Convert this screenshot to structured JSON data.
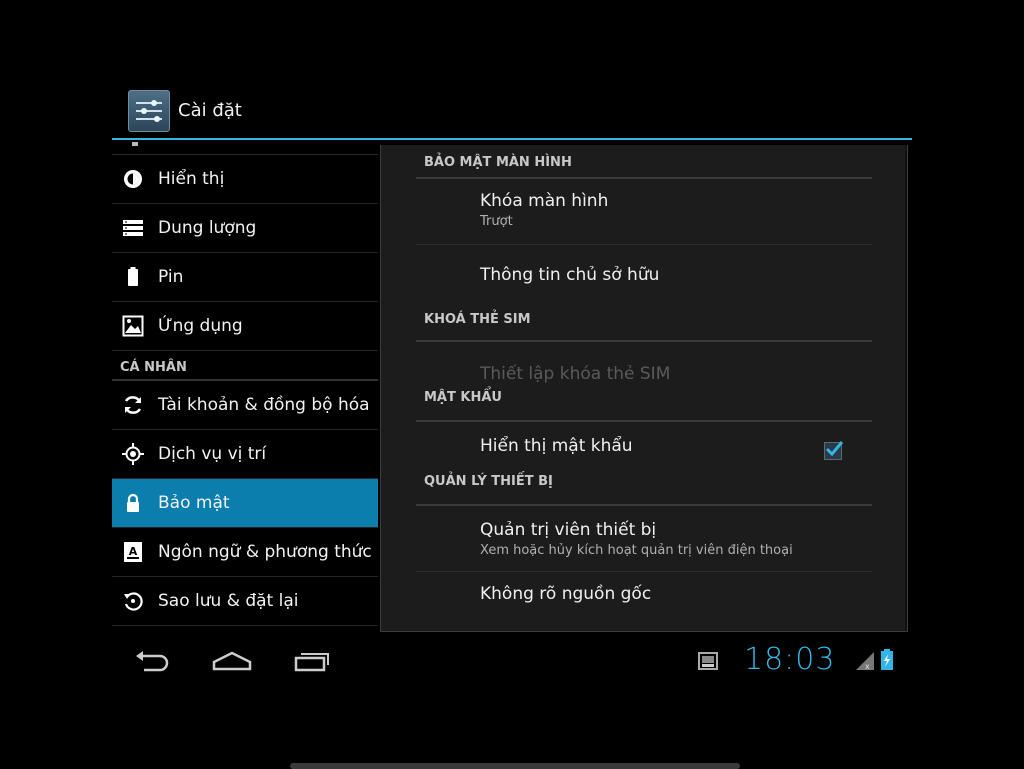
{
  "app": {
    "title": "Cài đặt",
    "icon": "settings-sliders-icon"
  },
  "sidebar": {
    "items_top": [
      {
        "label": "Hiển thị",
        "icon": "display-brightness-icon"
      },
      {
        "label": "Dung lượng",
        "icon": "storage-icon"
      },
      {
        "label": "Pin",
        "icon": "battery-icon"
      },
      {
        "label": "Ứng dụng",
        "icon": "apps-icon"
      }
    ],
    "personal_header": "CÁ NHÂN",
    "items_personal": [
      {
        "label": "Tài khoản & đồng bộ hóa",
        "icon": "sync-icon"
      },
      {
        "label": "Dịch vụ vị trí",
        "icon": "location-icon"
      },
      {
        "label": "Bảo mật",
        "icon": "lock-icon",
        "selected": true
      },
      {
        "label": "Ngôn ngữ & phương thức",
        "icon": "language-icon"
      },
      {
        "label": "Sao lưu & đặt lại",
        "icon": "backup-icon"
      }
    ]
  },
  "security": {
    "screen_security": {
      "header": "BẢO MẬT MÀN HÌNH",
      "screen_lock_title": "Khóa màn hình",
      "screen_lock_summary": "Trượt",
      "owner_info_title": "Thông tin chủ sở hữu"
    },
    "sim_lock": {
      "header": "KHOÁ THẺ SIM",
      "setup_title": "Thiết lập khóa thẻ SIM",
      "setup_enabled": false
    },
    "passwords": {
      "header": "MẬT KHẨU",
      "show_password_title": "Hiển thị mật khẩu",
      "show_password_checked": true
    },
    "device_admin": {
      "header": "QUẢN LÝ THIẾT BỊ",
      "admins_title": "Quản trị viên thiết bị",
      "admins_summary": "Xem hoặc hủy kích hoạt quản trị viên điện thoại",
      "unknown_sources_title": "Không rõ nguồn gốc"
    }
  },
  "system_bar": {
    "clock": "18:03",
    "accent": "#33b5e5",
    "nav_icons": [
      "back-icon",
      "home-icon",
      "recent-apps-icon"
    ],
    "status_icons": [
      "screenshot-notification-icon",
      "signal-icon",
      "battery-charging-icon"
    ]
  }
}
